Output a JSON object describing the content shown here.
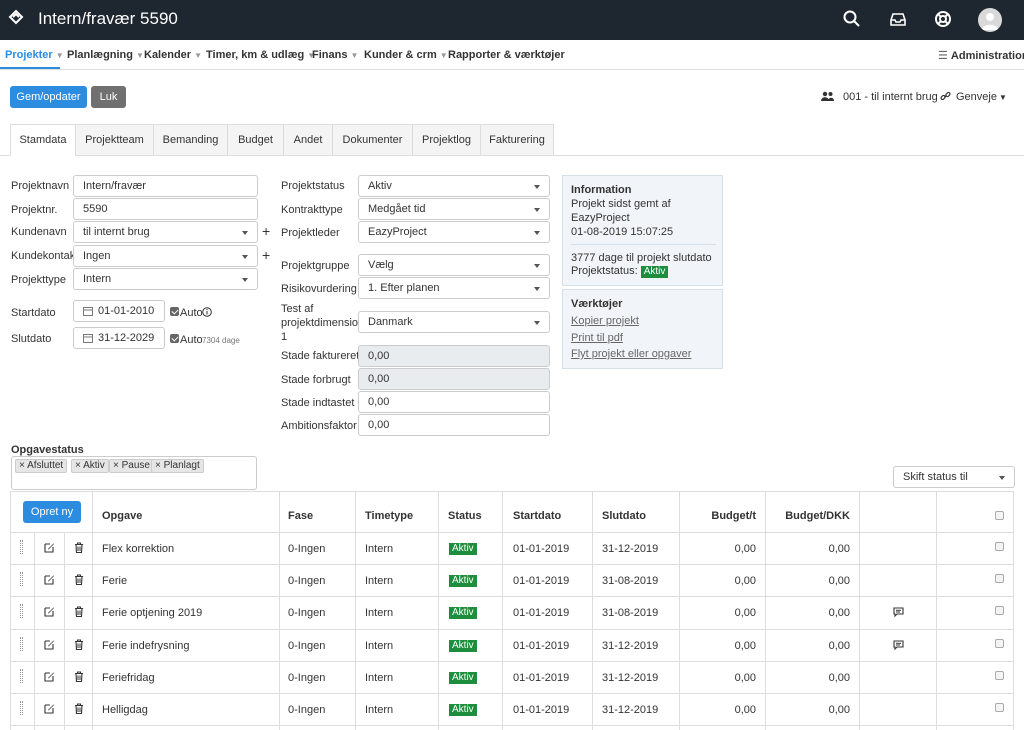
{
  "header": {
    "title": "Intern/fravær 5590"
  },
  "menu": {
    "items": [
      {
        "label": "Projekter",
        "dropdown": true
      },
      {
        "label": "Planlægning",
        "dropdown": true
      },
      {
        "label": "Kalender",
        "dropdown": true
      },
      {
        "label": "Timer, km & udlæg",
        "dropdown": true
      },
      {
        "label": "Finans",
        "dropdown": true
      },
      {
        "label": "Kunder & crm",
        "dropdown": true
      },
      {
        "label": "Rapporter & værktøjer",
        "dropdown": false
      }
    ],
    "admin_label": "Administration"
  },
  "actions": {
    "save_label": "Gem/opdater",
    "close_label": "Luk",
    "customer_label": "001 - til internt brug",
    "shortcuts_label": "Genveje"
  },
  "tabs": [
    "Stamdata",
    "Projektteam",
    "Bemanding",
    "Budget",
    "Andet",
    "Dokumenter",
    "Projektlog",
    "Fakturering"
  ],
  "form_left": {
    "projektnavn_label": "Projektnavn",
    "projektnavn_value": "Intern/fravær",
    "projektnr_label": "Projektnr.",
    "projektnr_value": "5590",
    "kundenavn_label": "Kundenavn",
    "kundenavn_value": "til internt brug",
    "kundekontakt_label": "Kundekontakt",
    "kundekontakt_value": "Ingen",
    "projekttype_label": "Projekttype",
    "projekttype_value": "Intern",
    "startdato_label": "Startdato",
    "startdato_value": "01-01-2010",
    "slutdato_label": "Slutdato",
    "slutdato_value": "31-12-2029",
    "auto_label": "Auto",
    "days_label": "7304 dage"
  },
  "form_mid": {
    "projektstatus_label": "Projektstatus",
    "projektstatus_value": "Aktiv",
    "kontrakttype_label": "Kontrakttype",
    "kontrakttype_value": "Medgået tid",
    "projektleder_label": "Projektleder",
    "projektleder_value": "EazyProject",
    "projektgruppe_label": "Projektgruppe",
    "projektgruppe_value": "Vælg",
    "risiko_label": "Risikovurdering",
    "risiko_value": "1. Efter planen",
    "testdim_label_1": "Test af",
    "testdim_label_2": "projektdimension",
    "testdim_label_3": "1",
    "testdim_value": "Danmark",
    "stade_fakt_label": "Stade faktureret",
    "stade_fakt_value": "0,00",
    "stade_forbrugt_label": "Stade forbrugt",
    "stade_forbrugt_value": "0,00",
    "stade_indtastet_label": "Stade indtastet",
    "stade_indtastet_value": "0,00",
    "ambition_label": "Ambitionsfaktor",
    "ambition_value": "0,00"
  },
  "info": {
    "title": "Information",
    "line1": "Projekt sidst gemt af",
    "line2": "EazyProject",
    "line3": "01-08-2019 15:07:25",
    "line4": "3777 dage til projekt slutdato",
    "status_label": "Projektstatus:",
    "status_value": "Aktiv"
  },
  "tools": {
    "title": "Værktøjer",
    "link1": "Kopier projekt",
    "link2": "Print til pdf",
    "link3": "Flyt projekt eller opgaver"
  },
  "opgavestatus": {
    "label": "Opgavestatus",
    "tags": [
      "× Afsluttet",
      "× Aktiv",
      "× Pause",
      "× Planlagt"
    ],
    "skift_label": "Skift status til"
  },
  "table": {
    "create_label": "Opret ny",
    "columns": [
      "Opgave",
      "Fase",
      "Timetype",
      "Status",
      "Startdato",
      "Slutdato",
      "Budget/t",
      "Budget/DKK"
    ],
    "rows": [
      {
        "opgave": "Flex korrektion",
        "fase": "0-Ingen",
        "timetype": "Intern",
        "status": "Aktiv",
        "start": "01-01-2019",
        "slut": "31-12-2019",
        "budget_t": "0,00",
        "budget_dkk": "0,00",
        "comment": false
      },
      {
        "opgave": "Ferie",
        "fase": "0-Ingen",
        "timetype": "Intern",
        "status": "Aktiv",
        "start": "01-01-2019",
        "slut": "31-08-2019",
        "budget_t": "0,00",
        "budget_dkk": "0,00",
        "comment": false
      },
      {
        "opgave": "Ferie optjening 2019",
        "fase": "0-Ingen",
        "timetype": "Intern",
        "status": "Aktiv",
        "start": "01-01-2019",
        "slut": "31-08-2019",
        "budget_t": "0,00",
        "budget_dkk": "0,00",
        "comment": true
      },
      {
        "opgave": "Ferie indefrysning",
        "fase": "0-Ingen",
        "timetype": "Intern",
        "status": "Aktiv",
        "start": "01-01-2019",
        "slut": "31-12-2019",
        "budget_t": "0,00",
        "budget_dkk": "0,00",
        "comment": true
      },
      {
        "opgave": "Feriefridag",
        "fase": "0-Ingen",
        "timetype": "Intern",
        "status": "Aktiv",
        "start": "01-01-2019",
        "slut": "31-12-2019",
        "budget_t": "0,00",
        "budget_dkk": "0,00",
        "comment": false
      },
      {
        "opgave": "Helligdag",
        "fase": "0-Ingen",
        "timetype": "Intern",
        "status": "Aktiv",
        "start": "01-01-2019",
        "slut": "31-12-2019",
        "budget_t": "0,00",
        "budget_dkk": "0,00",
        "comment": false
      }
    ]
  },
  "colors": {
    "header_bg": "#1e262f",
    "accent": "#2b8ce0",
    "status_green": "#1e8e3e"
  }
}
